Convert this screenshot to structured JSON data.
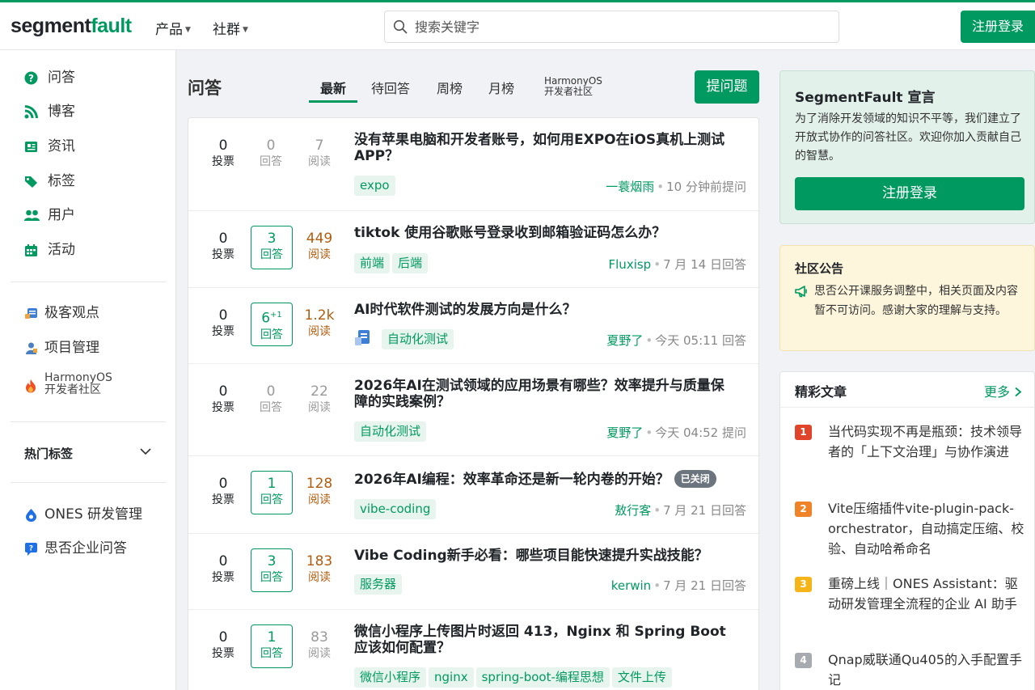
{
  "header": {
    "logo_prefix": "segment",
    "logo_suffix": "fault",
    "nav": [
      {
        "label": "产品"
      },
      {
        "label": "社群"
      }
    ],
    "search_placeholder": "搜索关键字",
    "register_label": "注册登录"
  },
  "sidebar": {
    "primary": [
      {
        "label": "问答",
        "icon": "question-circle-icon",
        "color": "#009a61"
      },
      {
        "label": "博客",
        "icon": "rss-icon",
        "color": "#009a61"
      },
      {
        "label": "资讯",
        "icon": "newspaper-icon",
        "color": "#009a61"
      },
      {
        "label": "标签",
        "icon": "tags-icon",
        "color": "#009a61"
      },
      {
        "label": "用户",
        "icon": "users-icon",
        "color": "#009a61"
      },
      {
        "label": "活动",
        "icon": "calendar-icon",
        "color": "#009a61"
      }
    ],
    "secondary": [
      {
        "label": "极客观点",
        "icon": "geek-icon"
      },
      {
        "label": "项目管理",
        "icon": "project-icon"
      }
    ],
    "harmony_line1": "HarmonyOS",
    "harmony_line2": "开发者社区",
    "hot_tags": "热门标签",
    "partners": [
      {
        "label": "ONES 研发管理",
        "icon": "ones-icon"
      },
      {
        "label": "思否企业问答",
        "icon": "enterprise-qa-icon"
      }
    ]
  },
  "main": {
    "title": "问答",
    "tabs": [
      {
        "label": "最新",
        "active": true
      },
      {
        "label": "待回答"
      },
      {
        "label": "周榜"
      },
      {
        "label": "月榜"
      }
    ],
    "tab_harmony_line1": "HarmonyOS",
    "tab_harmony_line2": "开发者社区",
    "ask_label": "提问题",
    "questions": [
      {
        "votes": "0",
        "votes_label": "投票",
        "answers": "0",
        "answers_label": "回答",
        "views": "7",
        "views_label": "阅读",
        "title": "没有苹果电脑和开发者账号，如何用EXPO在iOS真机上测试APP？",
        "tags": [
          "expo"
        ],
        "user": "一蓑烟雨",
        "time": "10 分钟前提问"
      },
      {
        "votes": "0",
        "votes_label": "投票",
        "answers": "3",
        "answers_label": "回答",
        "views": "449",
        "views_label": "阅读",
        "title": "tiktok 使用谷歌账号登录收到邮箱验证码怎么办？",
        "tags": [
          "前端",
          "后端"
        ],
        "user": "Fluxisp",
        "time": "7 月 14 日回答"
      },
      {
        "votes": "0",
        "votes_label": "投票",
        "answers": "6",
        "answers_sup": "+1",
        "answers_label": "回答",
        "views": "1.2k",
        "views_label": "阅读",
        "title": "AI时代软件测试的发展方向是什么？",
        "tags": [
          "自动化测试"
        ],
        "user": "夏野了",
        "time": "今天 05:11 回答"
      },
      {
        "votes": "0",
        "votes_label": "投票",
        "answers": "0",
        "answers_label": "回答",
        "views": "22",
        "views_label": "阅读",
        "title": "2026年AI在测试领域的应用场景有哪些？效率提升与质量保障的实践案例？",
        "tags": [
          "自动化测试"
        ],
        "user": "夏野了",
        "time": "今天 04:52 提问"
      },
      {
        "votes": "0",
        "votes_label": "投票",
        "answers": "1",
        "answers_label": "回答",
        "views": "128",
        "views_label": "阅读",
        "title": "2026年AI编程：效率革命还是新一轮内卷的开始？",
        "badge": "已关闭",
        "tags": [
          "vibe-coding"
        ],
        "user": "敖行客",
        "time": "7 月 21 日回答"
      },
      {
        "votes": "0",
        "votes_label": "投票",
        "answers": "3",
        "answers_label": "回答",
        "views": "183",
        "views_label": "阅读",
        "title": "Vibe Coding新手必看：哪些项目能快速提升实战技能？",
        "tags": [
          "服务器"
        ],
        "user": "kerwin",
        "time": "7 月 21 日回答"
      },
      {
        "votes": "0",
        "votes_label": "投票",
        "answers": "1",
        "answers_label": "回答",
        "views": "83",
        "views_label": "阅读",
        "title": "微信小程序上传图片时返回 413，Nginx 和 Spring Boot 应该如何配置？",
        "tags": [
          "微信小程序",
          "nginx",
          "spring-boot-编程思想",
          "文件上传"
        ],
        "user": "",
        "time": ""
      }
    ]
  },
  "right": {
    "manifesto": {
      "title": "SegmentFault 宣言",
      "text": "为了消除开发领域的知识不平等，我们建立了开放式协作的问答社区。欢迎你加入贡献自己的智慧。",
      "button": "注册登录"
    },
    "notice": {
      "title": "社区公告",
      "text": "思否公开课服务调整中，相关页面及内容暂不可访问。感谢大家的理解与支持。"
    },
    "articles": {
      "title": "精彩文章",
      "more": "更多",
      "items": [
        {
          "rank": "1",
          "color": "#e0452c",
          "text": "当代码实现不再是瓶颈：技术领导者的「上下文治理」与协作演进"
        },
        {
          "rank": "2",
          "color": "#f08228",
          "text": "Vite压缩插件vite-plugin-pack-orchestrator，自动搞定压缩、校验、自动哈希命名"
        },
        {
          "rank": "3",
          "color": "#f5b418",
          "text": "重磅上线｜ONES Assistant：驱动研发管理全流程的企业 AI 助手"
        },
        {
          "rank": "4",
          "color": "#a7abb0",
          "text": "Qnap威联通Qu405的入手配置手记"
        }
      ]
    }
  }
}
